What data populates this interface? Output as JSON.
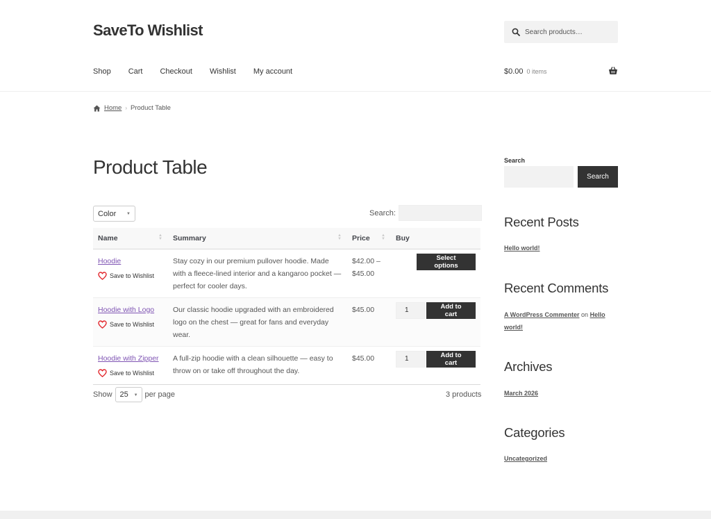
{
  "site": {
    "title": "SaveTo Wishlist",
    "search_placeholder": "Search products…",
    "nav": [
      "Shop",
      "Cart",
      "Checkout",
      "Wishlist",
      "My account"
    ],
    "cart_amount": "$0.00",
    "cart_items": "0 items"
  },
  "breadcrumb": {
    "home": "Home",
    "separator": "›",
    "current": "Product Table"
  },
  "page": {
    "title": "Product Table"
  },
  "filters": {
    "color_label": "Color",
    "search_label": "Search:"
  },
  "table": {
    "headers": {
      "name": "Name",
      "summary": "Summary",
      "price": "Price",
      "buy": "Buy"
    },
    "wishlist_label": "Save to Wishlist",
    "rows": [
      {
        "name": "Hoodie",
        "summary": "Stay cozy in our premium pullover hoodie. Made with a fleece-lined interior and a kangaroo pocket — perfect for cooler days.",
        "price": "$42.00 – $45.00",
        "action": "Select options"
      },
      {
        "name": "Hoodie with Logo",
        "summary": "Our classic hoodie upgraded with an embroidered logo on the chest — great for fans and everyday wear.",
        "price": "$45.00",
        "qty": "1",
        "action": "Add to cart"
      },
      {
        "name": "Hoodie with Zipper",
        "summary": "A full-zip hoodie with a clean silhouette — easy to throw on or take off throughout the day.",
        "price": "$45.00",
        "qty": "1",
        "action": "Add to cart"
      }
    ],
    "show_label": "Show",
    "per_page_value": "25",
    "per_page_label": "per page",
    "count": "3 products"
  },
  "sidebar": {
    "search_label": "Search",
    "search_button": "Search",
    "recent_posts_title": "Recent Posts",
    "recent_posts": [
      "Hello world!"
    ],
    "recent_comments_title": "Recent Comments",
    "comment_author": "A WordPress Commenter",
    "comment_on": "on",
    "comment_post": "Hello world!",
    "archives_title": "Archives",
    "archives": [
      "March 2026"
    ],
    "categories_title": "Categories",
    "categories": [
      "Uncategorized"
    ]
  },
  "colors": {
    "accent_link": "#7f54b3",
    "button_dark": "#333333",
    "heart": "#e2252b"
  },
  "icons": {
    "search": "search-icon",
    "basket": "basket-icon",
    "home": "home-icon",
    "heart": "heart-outline-icon"
  }
}
